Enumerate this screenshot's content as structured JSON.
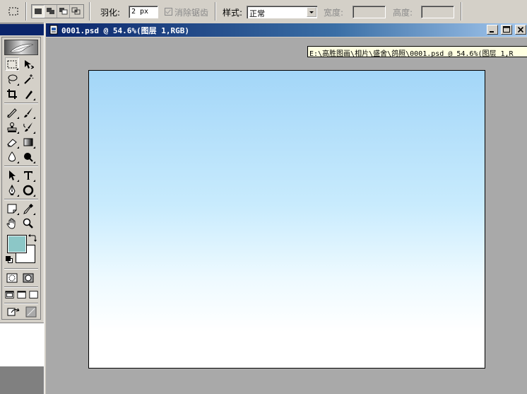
{
  "options_bar": {
    "feather_label": "羽化:",
    "feather_value": "2 px",
    "antialias_label": "消除锯齿",
    "style_label": "样式:",
    "style_value": "正常",
    "width_label": "宽度:",
    "height_label": "高度:",
    "width_value": "",
    "height_value": ""
  },
  "document": {
    "title": "0001.psd @ 54.6%(图层 1,RGB)",
    "path_tooltip": "E:\\高胜图画\\相片\\盛舍\\鸽照\\0001.psd @ 54.6%(图层 1,R",
    "gradient_top": "#a3d6f8",
    "gradient_bottom": "#ffffff"
  },
  "colors": {
    "foreground": "#8cc7c7",
    "background": "#ffffff",
    "titlebar_active": "#0a246a",
    "workspace": "#a9a9a9"
  },
  "toolbox": {
    "tools": [
      "rect-marquee-icon",
      "move-icon",
      "lasso-icon",
      "magic-wand-icon",
      "crop-icon",
      "slice-icon",
      "healing-brush-icon",
      "brush-icon",
      "clone-stamp-icon",
      "history-brush-icon",
      "eraser-icon",
      "gradient-icon",
      "blur-icon",
      "dodge-icon",
      "path-select-icon",
      "type-icon",
      "pen-icon",
      "ellipse-shape-icon",
      "notes-icon",
      "eyedropper-icon",
      "hand-icon",
      "zoom-icon"
    ]
  }
}
